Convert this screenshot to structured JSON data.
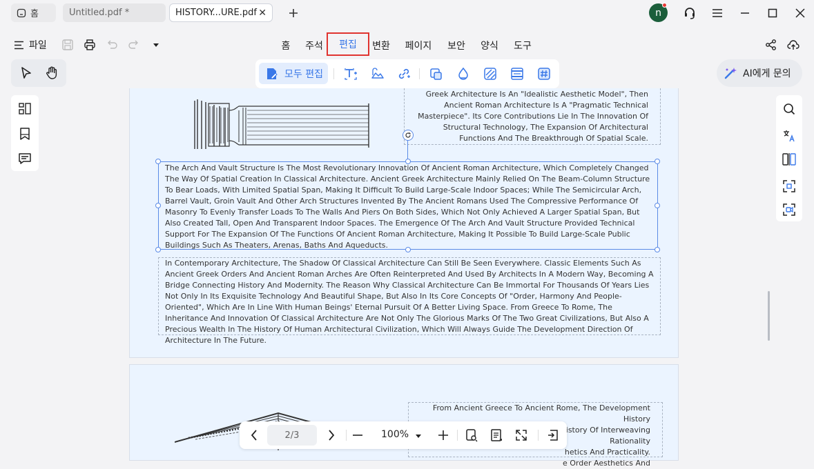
{
  "tabs": {
    "home": "홈",
    "untitled": "Untitled.pdf *",
    "history": "HISTORY...URE.pdf"
  },
  "user": {
    "avatar_letter": "n"
  },
  "menu": {
    "file": "파일",
    "nav": [
      "홈",
      "주석",
      "편집",
      "변환",
      "페이지",
      "보안",
      "양식",
      "도구"
    ],
    "active": "편집"
  },
  "edit_toolbar": {
    "edit_all": "모두 편집"
  },
  "ai": {
    "label": "AI에게 문의"
  },
  "document": {
    "top_right_text": "Greek Architecture Is An \"Idealistic Aesthetic Model\", Then Ancient Roman Architecture Is A \"Pragmatic Technical Masterpiece\". Its Core Contributions Lie In The Innovation Of Structural Technology, The Expansion Of Architectural Functions And The Breakthrough Of Spatial Scale.",
    "selected_text": "The Arch And Vault Structure Is The Most Revolutionary Innovation Of Ancient Roman Architecture, Which Completely Changed The Way Of Spatial Creation In Classical Architecture. Ancient Greek Architecture Mainly Relied On The Beam-Column Structure To Bear Loads, With Limited Spatial Span, Making It Difficult To Build Large-Scale Indoor Spaces; While The Semicircular Arch, Barrel Vault, Groin Vault And Other Arch Structures Invented By The Ancient Romans Used The Compressive Performance Of Masonry To Evenly Transfer Loads To The Walls And Piers On Both Sides, Which Not Only Achieved A Larger Spatial Span, But Also Created Tall, Open And Transparent Indoor Spaces. The Emergence Of The Arch And Vault Structure Provided Technical Support For The Expansion Of The Functions Of Ancient Roman Architecture, Making It Possible To Build Large-Scale Public Buildings Such As Theaters, Arenas, Baths And Aqueducts.",
    "contemporary_text": "In Contemporary Architecture, The Shadow Of Classical Architecture Can Still Be Seen Everywhere. Classic Elements Such As Ancient Greek Orders And Ancient Roman Arches Are Often Reinterpreted And Used By Architects In A Modern Way, Becoming A Bridge Connecting History And Modernity. The Reason Why Classical Architecture Can Be Immortal For Thousands Of Years Lies Not Only In Its Exquisite Technology And Beautiful Shape, But Also In Its Core Concepts Of \"Order, Harmony And People-Oriented\", Which Are In Line With Human Beings' Eternal Pursuit Of A Better Living Space. From Greece To Rome, The Inheritance And Innovation Of Classical Architecture Are Not Only The Glorious Marks Of The Two Great Civilizations, But Also A Precious Wealth In The History Of Human Architectural Civilization, Which Will Always Guide The Development Direction Of Architecture In The Future.",
    "page3_lines": [
      "From Ancient Greece To Ancient Rome, The Development History",
      "Of Classical Architecture Is A History Of Interweaving Rationality",
      "hetics And Practicality.",
      "e Order Aesthetics And"
    ]
  },
  "pagination": {
    "page_indicator": "2/3",
    "zoom": "100%"
  }
}
